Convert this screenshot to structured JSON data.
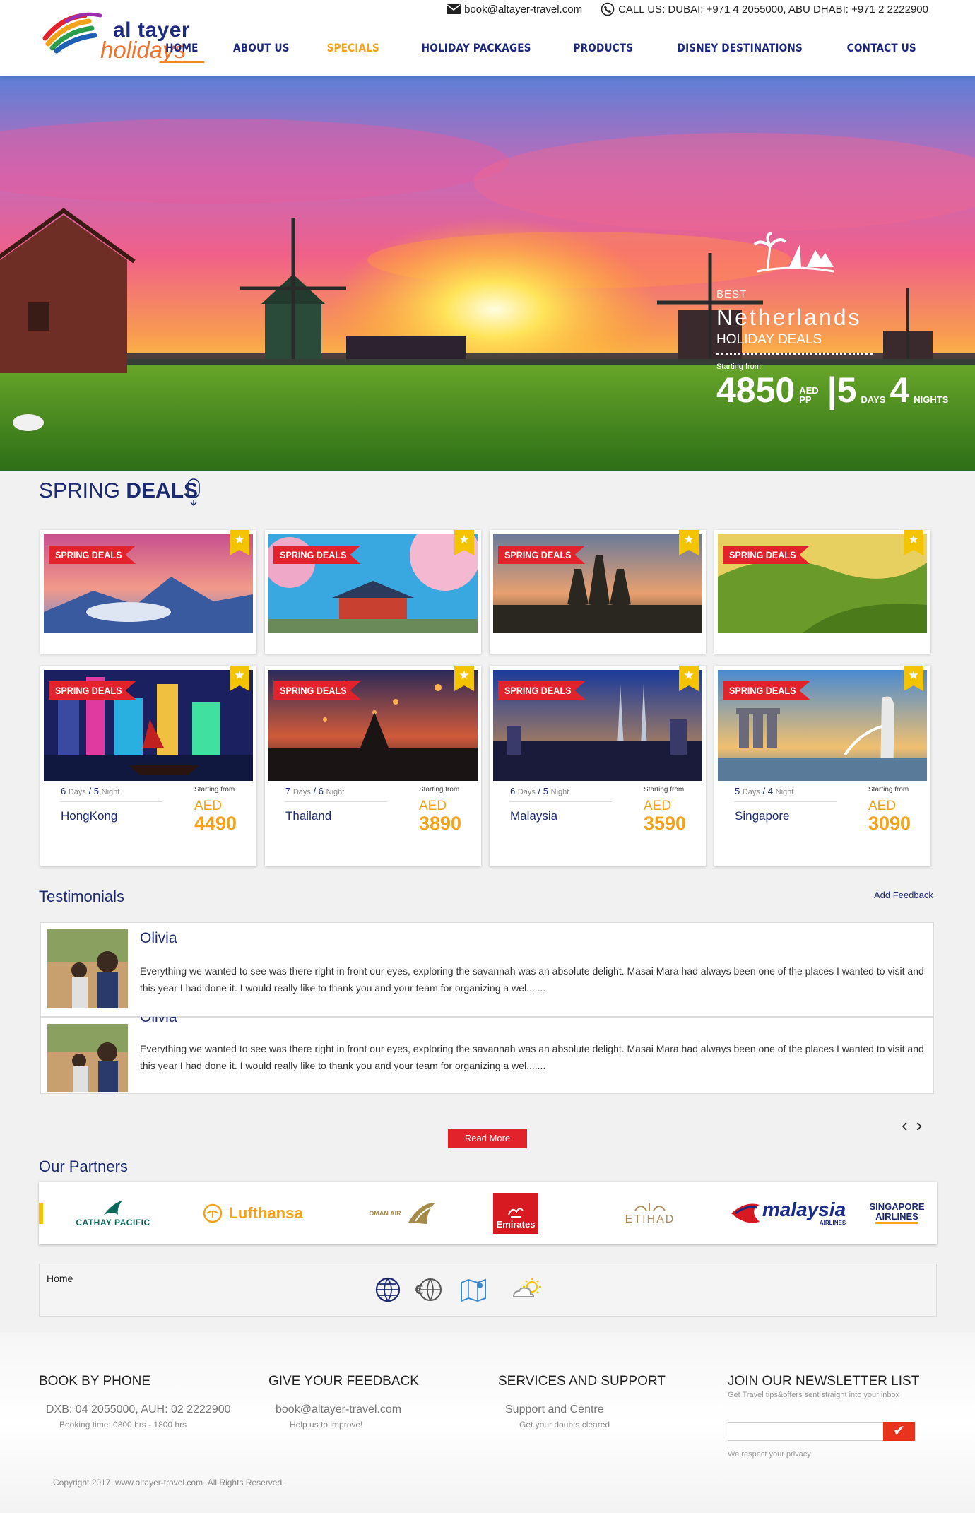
{
  "brand": {
    "line1": "al tayer",
    "line2": "holidays"
  },
  "contact": {
    "email": "book@altayer-travel.com",
    "phone": "CALL US: DUBAI: +971 4 2055000, ABU DHABI: +971 2 2222900"
  },
  "nav": [
    {
      "label": "HOME"
    },
    {
      "label": "ABOUT US"
    },
    {
      "label": "SPECIALS"
    },
    {
      "label": "HOLIDAY PACKAGES"
    },
    {
      "label": "PRODUCTS"
    },
    {
      "label": "DISNEY DESTINATIONS"
    },
    {
      "label": "CONTACT US"
    }
  ],
  "hero": {
    "best": "BEST",
    "destination": "Netherlands",
    "deals": "HOLIDAY DEALS",
    "starting": "Starting from",
    "price": "4850",
    "price_unit_1": "AED",
    "price_unit_2": "PP",
    "days": "5",
    "days_label": "DAYS",
    "nights": "4",
    "nights_label": "NIGHTS"
  },
  "spring": {
    "title_a": "SPRING",
    "title_b": "DEALS",
    "badge": "SPRING DEALS",
    "star": "★"
  },
  "deals": [
    {
      "days": "6",
      "days_label": "Days",
      "nights": "5",
      "nights_label": "Night",
      "place": "HongKong",
      "starting": "Starting from",
      "currency": "AED",
      "price": "4490"
    },
    {
      "days": "7",
      "days_label": "Days",
      "nights": "6",
      "nights_label": "Night",
      "place": "Thailand",
      "starting": "Starting from",
      "currency": "AED",
      "price": "3890"
    },
    {
      "days": "6",
      "days_label": "Days",
      "nights": "5",
      "nights_label": "Night",
      "place": "Malaysia",
      "starting": "Starting from",
      "currency": "AED",
      "price": "3590"
    },
    {
      "days": "5",
      "days_label": "Days",
      "nights": "4",
      "nights_label": "Night",
      "place": "Singapore",
      "starting": "Starting from",
      "currency": "AED",
      "price": "3090"
    }
  ],
  "testimonials": {
    "title": "Testimonials",
    "add_feedback": "Add Feedback",
    "items": [
      {
        "name": "Olivia",
        "text": "Everything we wanted to see was there right in front our eyes, exploring the savannah was an absolute delight. Masai Mara had always been one of the places I wanted to visit and this year I had done it. I would really like to thank you and your team for organizing a wel......."
      },
      {
        "name": "Olivia",
        "text": "Everything we wanted to see was there right in front our eyes, exploring the savannah was an absolute delight. Masai Mara had always been one of the places I wanted to visit and this year I had done it. I would really like to thank you and your team for organizing a wel......."
      }
    ],
    "prev": "‹",
    "next": "›",
    "read_more": "Read More"
  },
  "partners": {
    "title": "Our Partners",
    "logos": [
      {
        "name": "CATHAY PACIFIC",
        "color": "#0a6a5c"
      },
      {
        "name": "Lufthansa",
        "color": "#f3a21a"
      },
      {
        "name": "OMAN AIR",
        "color": "#a58a4a"
      },
      {
        "name": "Emirates",
        "color": "#d71921"
      },
      {
        "name": "ETIHAD",
        "color": "#b08d57"
      },
      {
        "name": "malaysia",
        "sub": "AIRLINES",
        "color": "#1b2c88"
      },
      {
        "name": "SINGAPORE",
        "sub": "AIRLINES",
        "color": "#1c2a72"
      }
    ]
  },
  "bottombar": {
    "home": "Home"
  },
  "footer": {
    "col1": {
      "title": "BOOK BY PHONE",
      "line1": "DXB: 04 2055000, AUH: 02 2222900",
      "line2": "Booking time: 0800 hrs - 1800 hrs"
    },
    "col2": {
      "title": "GIVE YOUR FEEDBACK",
      "line1": "book@altayer-travel.com",
      "line2": "Help us to improve!"
    },
    "col3": {
      "title": "SERVICES AND SUPPORT",
      "line1": "Support and Centre",
      "line2": "Get your doubts cleared"
    },
    "col4": {
      "title": "JOIN OUR NEWSLETTER LIST",
      "sub": "Get Travel tips&offers sent straight into your inbox",
      "privacy": "We respect your privacy",
      "submit": "✔"
    },
    "copyright": "Copyright 2017. www.altayer-travel.com .All Rights Reserved."
  }
}
